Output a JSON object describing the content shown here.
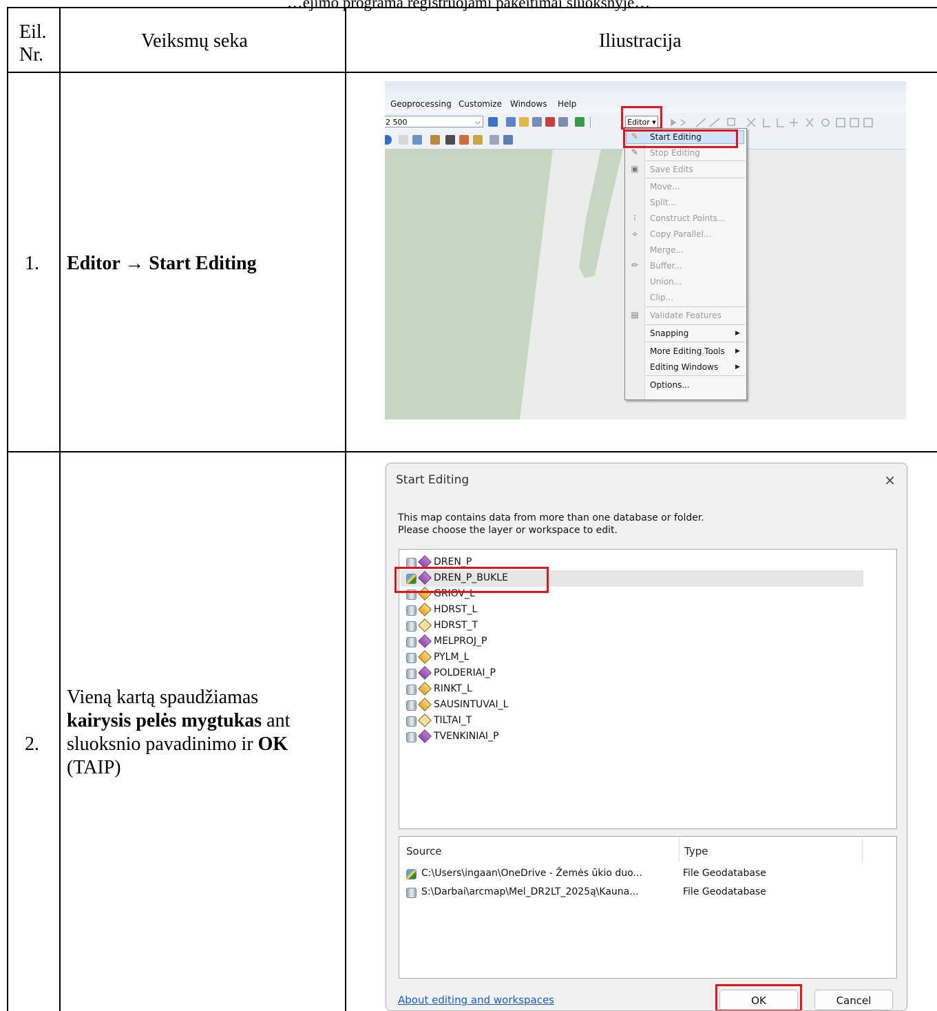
{
  "top_text": "…ėjimo programa registruojami pakeitimai sluoksnyje…",
  "table": {
    "header": {
      "col_nr_line1": "Eil.",
      "col_nr_line2": "Nr.",
      "col_steps": "Veiksmų seka",
      "col_illustration": "Iliustracija"
    },
    "rows": [
      {
        "nr": "1.",
        "step_text": "Editor → Start Editing"
      },
      {
        "nr": "2.",
        "step_line1": "Vieną kartą spaudžiamas",
        "step_line2_bold": "kairysis pelės mygtukas",
        "step_line2_rest": " ant",
        "step_line3_a": "sluoksnio pavadinimo ir ",
        "step_line3_bold": "OK",
        "step_line4": "(TAIP)"
      }
    ]
  },
  "screenshot1": {
    "menu": [
      "Geoprocessing",
      "Customize",
      "Windows",
      "Help"
    ],
    "scale_value": "2 500",
    "editor_button": "Editor ▾",
    "dropdown_items": [
      {
        "label": "Start Editing",
        "enabled": true,
        "icon": "pencil-icon"
      },
      {
        "label": "Stop Editing",
        "enabled": false,
        "icon": "pencil-icon"
      },
      {
        "label": "Save Edits",
        "enabled": false,
        "icon": "save-icon"
      },
      {
        "label": "Move...",
        "enabled": false
      },
      {
        "label": "Split...",
        "enabled": false
      },
      {
        "label": "Construct Points...",
        "enabled": false,
        "icon": "points-icon"
      },
      {
        "label": "Copy Parallel...",
        "enabled": false,
        "icon": "parallel-icon"
      },
      {
        "label": "Merge...",
        "enabled": false
      },
      {
        "label": "Buffer...",
        "enabled": false,
        "icon": "buffer-icon"
      },
      {
        "label": "Union...",
        "enabled": false
      },
      {
        "label": "Clip...",
        "enabled": false
      },
      {
        "label": "Validate Features",
        "enabled": false,
        "icon": "validate-icon"
      },
      {
        "label": "Snapping",
        "enabled": true,
        "submenu": true
      },
      {
        "label": "More Editing Tools",
        "enabled": true,
        "submenu": true
      },
      {
        "label": "Editing Windows",
        "enabled": true,
        "submenu": true
      },
      {
        "label": "Options...",
        "enabled": true
      }
    ]
  },
  "dialog": {
    "title": "Start Editing",
    "close_glyph": "×",
    "message": "This map contains data from more than one database or folder.\nPlease choose the layer or workspace to edit.",
    "layers": [
      {
        "name": "DREN_P",
        "geom": "poly",
        "selected": false
      },
      {
        "name": "DREN_P_BUKLE",
        "geom": "poly",
        "selected": true
      },
      {
        "name": "GRIOV_L",
        "geom": "line",
        "selected": false
      },
      {
        "name": "HDRST_L",
        "geom": "line",
        "selected": false
      },
      {
        "name": "HDRST_T",
        "geom": "pt",
        "selected": false
      },
      {
        "name": "MELPROJ_P",
        "geom": "poly",
        "selected": false
      },
      {
        "name": "PYLM_L",
        "geom": "line",
        "selected": false
      },
      {
        "name": "POLDERIAI_P",
        "geom": "poly",
        "selected": false
      },
      {
        "name": "RINKT_L",
        "geom": "line",
        "selected": false
      },
      {
        "name": "SAUSINTUVAI_L",
        "geom": "line",
        "selected": false
      },
      {
        "name": "TILTAI_T",
        "geom": "pt",
        "selected": false
      },
      {
        "name": "TVENKINIAI_P",
        "geom": "poly",
        "selected": false
      }
    ],
    "source_header": "Source",
    "type_header": "Type",
    "sources": [
      {
        "path": "C:\\Users\\ingaan\\OneDrive - Žemės ūkio duo...",
        "type": "File Geodatabase",
        "editable": true
      },
      {
        "path": "S:\\Darbai\\arcmap\\Mel_DR2LT_2025ą\\Kauna...",
        "type": "File Geodatabase",
        "editable": false
      }
    ],
    "help_link": "About editing and workspaces",
    "ok_label": "OK",
    "cancel_label": "Cancel"
  },
  "colors": {
    "highlight_red": "#e5141c",
    "map_green": "#c9d8c2",
    "link_blue": "#1a5bd0"
  }
}
